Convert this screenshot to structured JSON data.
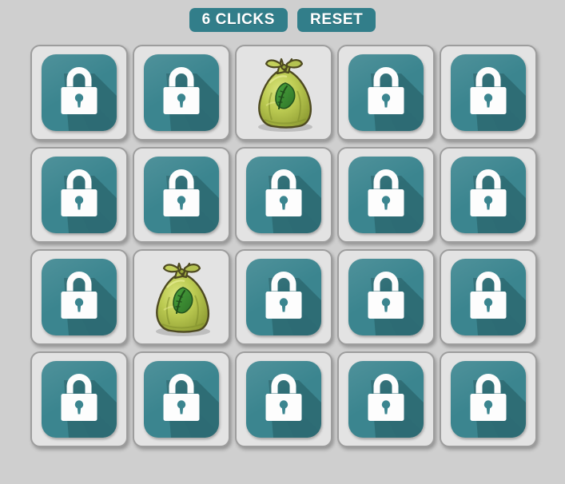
{
  "header": {
    "clicks_label": "6 CLICKS",
    "clicks_count": 6,
    "reset_label": "RESET"
  },
  "colors": {
    "background": "#cfcfcf",
    "button": "#327e8a",
    "button_text": "#ffffff",
    "card_face": "#e3e3e3",
    "card_border": "#9d9d9d",
    "tile_teal": "#3b858f",
    "tile_shadow": "#2d6c74",
    "lock_white": "#fdfdfd",
    "bag_green": "#b7c44e",
    "bag_outline": "#4e4a21",
    "leaf_green": "#3d8b34"
  },
  "board": {
    "rows": 4,
    "columns": 5,
    "cards": [
      {
        "index": 0,
        "row": 1,
        "col": 1,
        "state": "face-down",
        "icon": "lock-icon"
      },
      {
        "index": 1,
        "row": 1,
        "col": 2,
        "state": "face-down",
        "icon": "lock-icon"
      },
      {
        "index": 2,
        "row": 1,
        "col": 3,
        "state": "face-up",
        "icon": "green-bag-icon"
      },
      {
        "index": 3,
        "row": 1,
        "col": 4,
        "state": "face-down",
        "icon": "lock-icon"
      },
      {
        "index": 4,
        "row": 1,
        "col": 5,
        "state": "face-down",
        "icon": "lock-icon"
      },
      {
        "index": 5,
        "row": 2,
        "col": 1,
        "state": "face-down",
        "icon": "lock-icon"
      },
      {
        "index": 6,
        "row": 2,
        "col": 2,
        "state": "face-down",
        "icon": "lock-icon"
      },
      {
        "index": 7,
        "row": 2,
        "col": 3,
        "state": "face-down",
        "icon": "lock-icon"
      },
      {
        "index": 8,
        "row": 2,
        "col": 4,
        "state": "face-down",
        "icon": "lock-icon"
      },
      {
        "index": 9,
        "row": 2,
        "col": 5,
        "state": "face-down",
        "icon": "lock-icon"
      },
      {
        "index": 10,
        "row": 3,
        "col": 1,
        "state": "face-down",
        "icon": "lock-icon"
      },
      {
        "index": 11,
        "row": 3,
        "col": 2,
        "state": "face-up",
        "icon": "green-bag-icon"
      },
      {
        "index": 12,
        "row": 3,
        "col": 3,
        "state": "face-down",
        "icon": "lock-icon"
      },
      {
        "index": 13,
        "row": 3,
        "col": 4,
        "state": "face-down",
        "icon": "lock-icon"
      },
      {
        "index": 14,
        "row": 3,
        "col": 5,
        "state": "face-down",
        "icon": "lock-icon"
      },
      {
        "index": 15,
        "row": 4,
        "col": 1,
        "state": "face-down",
        "icon": "lock-icon"
      },
      {
        "index": 16,
        "row": 4,
        "col": 2,
        "state": "face-down",
        "icon": "lock-icon"
      },
      {
        "index": 17,
        "row": 4,
        "col": 3,
        "state": "face-down",
        "icon": "lock-icon"
      },
      {
        "index": 18,
        "row": 4,
        "col": 4,
        "state": "face-down",
        "icon": "lock-icon"
      },
      {
        "index": 19,
        "row": 4,
        "col": 5,
        "state": "face-down",
        "icon": "lock-icon"
      }
    ]
  }
}
